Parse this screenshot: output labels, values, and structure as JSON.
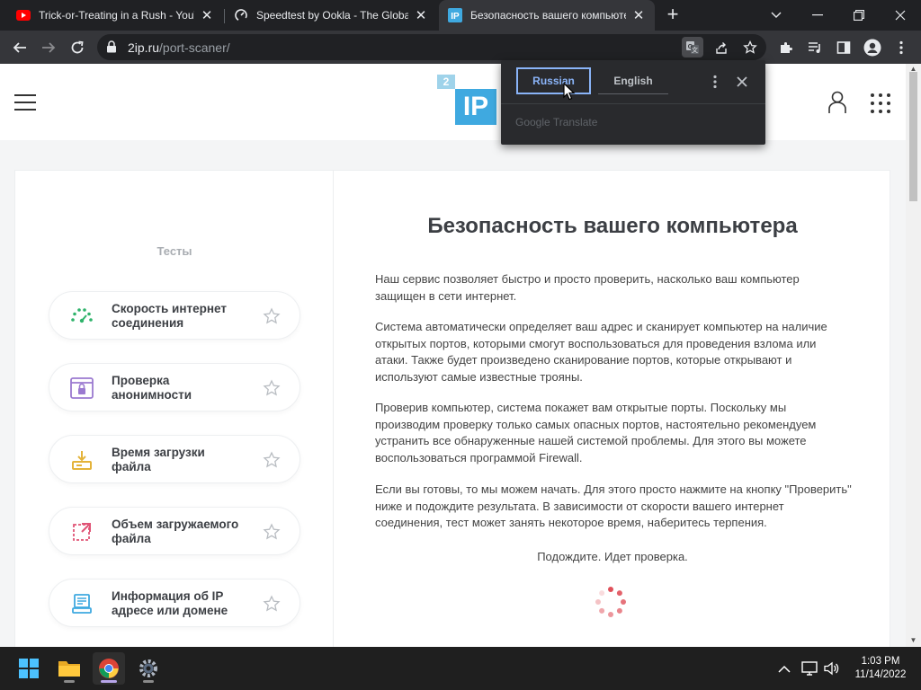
{
  "browser": {
    "tabs": [
      {
        "title": "Trick-or-Treating in a Rush - YouT",
        "icon": "youtube-icon"
      },
      {
        "title": "Speedtest by Ookla - The Global",
        "icon": "speedtest-icon"
      },
      {
        "title": "Безопасность вашего компьюте",
        "icon": "2ip-icon"
      }
    ],
    "address_host": "2ip.ru",
    "address_path": "/port-scaner/"
  },
  "translate_popup": {
    "source_language": "Russian",
    "target_language": "English",
    "brand": "Google Translate"
  },
  "site": {
    "logo_small": "2",
    "logo_big": "IP"
  },
  "sidebar": {
    "heading": "Тесты",
    "items": [
      {
        "label": "Скорость интернет соединения",
        "icon": "speedometer-icon"
      },
      {
        "label": "Проверка анонимности",
        "icon": "anonymity-lock-icon"
      },
      {
        "label": "Время загрузки файла",
        "icon": "download-icon"
      },
      {
        "label": "Объем загружаемого файла",
        "icon": "file-size-icon"
      },
      {
        "label": "Информация об IP адресе или домене",
        "icon": "ip-info-icon"
      }
    ]
  },
  "main": {
    "title": "Безопасность вашего компьютера",
    "paragraphs": [
      "Наш сервис позволяет быстро и просто проверить, насколько ваш компьютер защищен в сети интернет.",
      "Система автоматически определяет ваш адрес и сканирует компьютер на наличие открытых портов, которыми смогут воспользоваться для проведения взлома или атаки. Также будет произведено сканирование портов, которые открывают и используют самые известные трояны.",
      "Проверив компьютер, система покажет вам открытые порты. Поскольку мы производим проверку только самых опасных портов, настоятельно рекомендуем устранить все обнаруженные нашей системой проблемы. Для этого вы можете воспользоваться программой Firewall.",
      "Если вы готовы, то мы можем начать. Для этого просто нажмите на кнопку \"Проверить\" ниже и подождите результата. В зависимости от скорости вашего интернет соединения, тест может занять некоторое время, наберитесь терпения."
    ],
    "status": "Подождите. Идет проверка."
  },
  "taskbar": {
    "time": "1:03 PM",
    "date": "11/14/2022"
  },
  "colors": {
    "accent_blue": "#3fa9e0",
    "translate_selected": "#8ab4f8",
    "spinner_red": "#e0505a"
  }
}
